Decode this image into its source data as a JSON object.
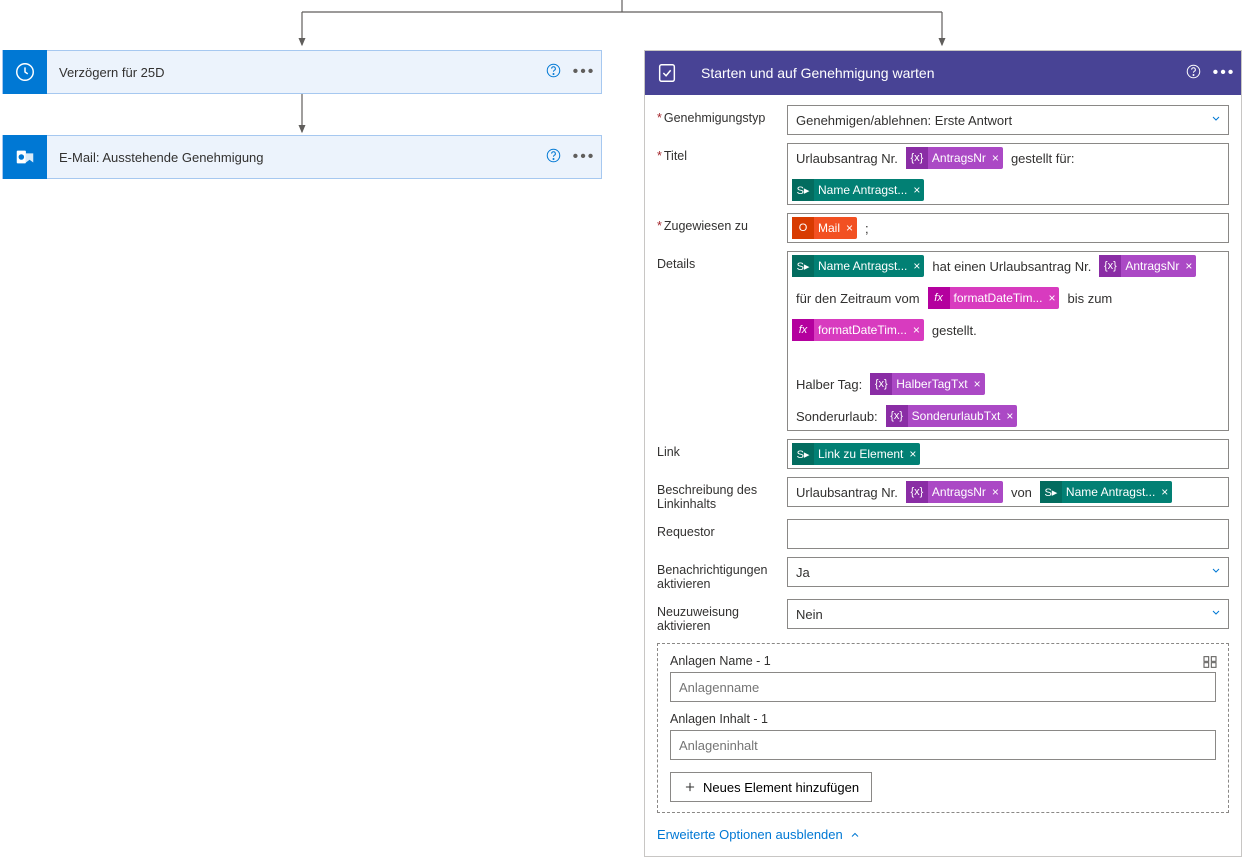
{
  "leftBranch": {
    "delayAction": {
      "title": "Verzögern für 25D"
    },
    "emailAction": {
      "title": "E-Mail: Ausstehende Genehmigung"
    }
  },
  "approval": {
    "headerTitle": "Starten und auf Genehmigung warten",
    "labels": {
      "approvalType": "Genehmigungstyp",
      "title": "Titel",
      "assignedTo": "Zugewiesen zu",
      "details": "Details",
      "link": "Link",
      "linkDesc": "Beschreibung des Linkinhalts",
      "requestor": "Requestor",
      "notifications": "Benachrichtigungen aktivieren",
      "reassignment": "Neuzuweisung aktivieren",
      "attachName": "Anlagen Name - 1",
      "attachNamePH": "Anlagenname",
      "attachContent": "Anlagen Inhalt - 1",
      "attachContentPH": "Anlageninhalt",
      "addNew": "Neues Element hinzufügen",
      "hideAdvanced": "Erweiterte Optionen ausblenden"
    },
    "values": {
      "approvalType": "Genehmigen/ablehnen: Erste Antwort",
      "notifications": "Ja",
      "reassignment": "Nein"
    },
    "titleField": {
      "prefix": "Urlaubsantrag Nr.",
      "token1": "AntragsNr",
      "suffix1": "gestellt für:",
      "token2": "Name Antragst..."
    },
    "assignedTo": {
      "mailToken": "Mail",
      "separator": ";"
    },
    "details": {
      "token1": "Name Antragst...",
      "text1": "hat einen Urlaubsantrag Nr.",
      "token2": "AntragsNr",
      "text2": "für den Zeitraum vom",
      "token3": "formatDateTim...",
      "text3": "bis zum",
      "token4": "formatDateTim...",
      "text4": "gestellt.",
      "halfDayLabel": "Halber Tag:",
      "halfDayToken": "HalberTagTxt",
      "specialLabel": "Sonderurlaub:",
      "specialToken": "SonderurlaubTxt"
    },
    "link": {
      "token": "Link zu Element"
    },
    "linkDesc": {
      "prefix": "Urlaubsantrag Nr.",
      "token1": "AntragsNr",
      "mid": "von",
      "token2": "Name Antragst..."
    }
  },
  "glyphs": {
    "fx": "{x}",
    "fxItalic": "fx",
    "sp": "S▸"
  }
}
